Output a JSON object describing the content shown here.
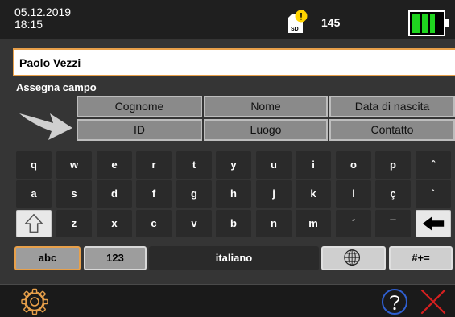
{
  "status": {
    "date": "05.12.2019",
    "time": "18:15",
    "sd_label": "SD",
    "sd_alert": "!",
    "sd_count": "145",
    "battery_level": 0.75,
    "battery_color": "#1fd41f"
  },
  "input": {
    "value": "Paolo Vezzi"
  },
  "assign": {
    "title": "Assegna campo",
    "fields": [
      "Cognome",
      "Nome",
      "Data di nascita",
      "ID",
      "Luogo",
      "Contatto"
    ]
  },
  "keyboard": {
    "row1": [
      "q",
      "w",
      "e",
      "r",
      "t",
      "y",
      "u",
      "i",
      "o",
      "p",
      "ˆ"
    ],
    "row2": [
      "a",
      "s",
      "d",
      "f",
      "g",
      "h",
      "j",
      "k",
      "l",
      "ç",
      "`"
    ],
    "row3": [
      "z",
      "x",
      "c",
      "v",
      "b",
      "n",
      "m",
      "´",
      "¯"
    ],
    "abc_label": "abc",
    "num_label": "123",
    "space_label": "italiano",
    "sym_label": "#+="
  },
  "colors": {
    "accent": "#e8a04a",
    "close": "#d62020",
    "help": "#2f5fd0"
  }
}
